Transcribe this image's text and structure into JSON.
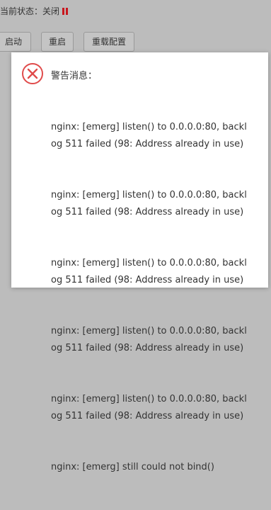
{
  "status": {
    "label": "当前状态：",
    "value": "关闭",
    "indicator_icon": "stop-icon",
    "indicator_color": "#c8161d"
  },
  "buttons": {
    "start": "启动",
    "restart": "重启",
    "reconfig": "重载配置"
  },
  "dialog": {
    "icon": "error-x-icon",
    "icon_color": "#e04b4b",
    "title": "警告消息：",
    "lines": [
      "nginx: [emerg] listen() to 0.0.0.0:80, backlog 511 failed (98: Address already in use)",
      "nginx: [emerg] listen() to 0.0.0.0:80, backlog 511 failed (98: Address already in use)",
      "nginx: [emerg] listen() to 0.0.0.0:80, backlog 511 failed (98: Address already in use)",
      "nginx: [emerg] listen() to 0.0.0.0:80, backlog 511 failed (98: Address already in use)",
      "nginx: [emerg] listen() to 0.0.0.0:80, backlog 511 failed (98: Address already in use)",
      "nginx: [emerg] still could not bind()"
    ]
  }
}
